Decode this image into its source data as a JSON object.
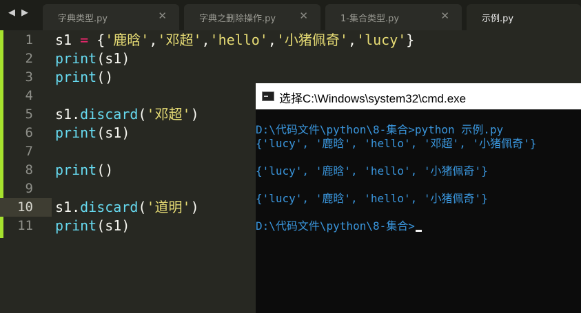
{
  "tabbar": {
    "nav_left": "◀",
    "nav_right": "▶",
    "close_glyph": "✕",
    "tabs": [
      {
        "label": "字典类型.py"
      },
      {
        "label": "字典之删除操作.py"
      },
      {
        "label": "1-集合类型.py"
      },
      {
        "label": "示例.py"
      }
    ]
  },
  "editor": {
    "active_line": 10,
    "line_numbers": [
      "1",
      "2",
      "3",
      "4",
      "5",
      "6",
      "7",
      "8",
      "9",
      "10",
      "11"
    ],
    "lines": [
      [
        {
          "t": "s1 ",
          "c": "pn"
        },
        {
          "t": "=",
          "c": "op"
        },
        {
          "t": " {",
          "c": "pn"
        },
        {
          "t": "'鹿晗'",
          "c": "str"
        },
        {
          "t": ",",
          "c": "pn"
        },
        {
          "t": "'邓超'",
          "c": "str"
        },
        {
          "t": ",",
          "c": "pn"
        },
        {
          "t": "'hello'",
          "c": "str"
        },
        {
          "t": ",",
          "c": "pn"
        },
        {
          "t": "'小猪佩奇'",
          "c": "str"
        },
        {
          "t": ",",
          "c": "pn"
        },
        {
          "t": "'lucy'",
          "c": "str"
        },
        {
          "t": "}",
          "c": "pn"
        }
      ],
      [
        {
          "t": "print",
          "c": "kw"
        },
        {
          "t": "(s1)",
          "c": "pn"
        }
      ],
      [
        {
          "t": "print",
          "c": "kw"
        },
        {
          "t": "()",
          "c": "pn"
        }
      ],
      [],
      [
        {
          "t": "s1.",
          "c": "pn"
        },
        {
          "t": "discard",
          "c": "kw"
        },
        {
          "t": "(",
          "c": "pn"
        },
        {
          "t": "'邓超'",
          "c": "str"
        },
        {
          "t": ")",
          "c": "pn"
        }
      ],
      [
        {
          "t": "print",
          "c": "kw"
        },
        {
          "t": "(s1)",
          "c": "pn"
        }
      ],
      [],
      [
        {
          "t": "print",
          "c": "kw"
        },
        {
          "t": "()",
          "c": "pn"
        }
      ],
      [],
      [
        {
          "t": "s1.",
          "c": "pn"
        },
        {
          "t": "discard",
          "c": "kw"
        },
        {
          "t": "(",
          "c": "pn"
        },
        {
          "t": "'道明'",
          "c": "str"
        },
        {
          "t": ")",
          "c": "pn"
        }
      ],
      [
        {
          "t": "print",
          "c": "kw"
        },
        {
          "t": "(s1)",
          "c": "pn"
        }
      ]
    ]
  },
  "cmd": {
    "title": "选择C:\\Windows\\system32\\cmd.exe",
    "lines": [
      "D:\\代码文件\\python\\8-集合>python 示例.py",
      "{'lucy', '鹿晗', 'hello', '邓超', '小猪佩奇'}",
      "",
      "{'lucy', '鹿晗', 'hello', '小猪佩奇'}",
      "",
      "{'lucy', '鹿晗', 'hello', '小猪佩奇'}",
      "",
      "D:\\代码文件\\python\\8-集合>"
    ],
    "colors": {
      "text": "#3a96dd",
      "background": "#0c0c0c"
    }
  },
  "colors": {
    "editor_bg": "#272822",
    "keyword": "#66d9ef",
    "string": "#e6db74",
    "operator": "#f92672",
    "gutter_mark": "#a6e22e"
  }
}
